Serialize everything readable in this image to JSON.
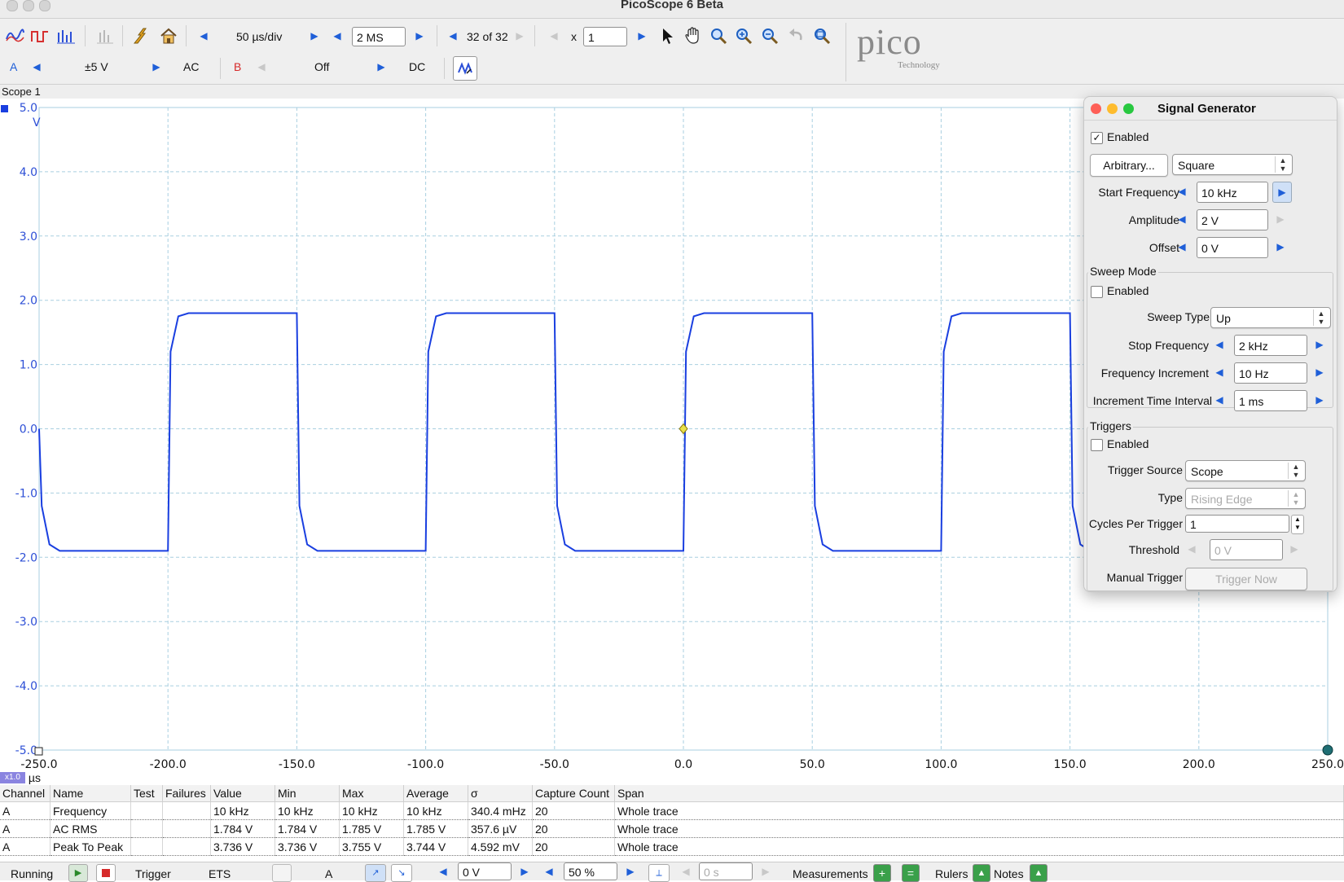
{
  "window": {
    "title": "PicoScope 6 Beta"
  },
  "toolbar": {
    "timebase": "50 µs/div",
    "samples": "2 MS",
    "capture": "32 of 32",
    "zoom_prefix": "x",
    "zoom_value": "1"
  },
  "channels": {
    "a": {
      "name": "A",
      "range": "±5 V",
      "coupling": "AC"
    },
    "b": {
      "name": "B",
      "range": "Off",
      "coupling": "DC"
    }
  },
  "logo": {
    "text": "pico",
    "sub": "Technology"
  },
  "scope": {
    "label": "Scope 1",
    "y_unit": "V",
    "x_unit": "µs",
    "x_scale_badge": "x1.0",
    "colors": {
      "trace": "#1a3fe0",
      "axis_text": "#2d4fd6",
      "grid": "#a9cfe0",
      "marker": "#e8e04a"
    }
  },
  "chart_data": {
    "type": "line",
    "x_range": [
      -250,
      250
    ],
    "y_range": [
      -5,
      5
    ],
    "x_ticks": [
      "-250.0",
      "-200.0",
      "-150.0",
      "-100.0",
      "-50.0",
      "0.0",
      "50.0",
      "100.0",
      "150.0",
      "200.0",
      "250.0"
    ],
    "y_ticks": [
      "5.0",
      "4.0",
      "3.0",
      "2.0",
      "1.0",
      "0.0",
      "-1.0",
      "-2.0",
      "-3.0",
      "-4.0",
      "-5.0"
    ],
    "grid": true,
    "series": [
      {
        "waveform": "square",
        "high": 1.8,
        "low": -1.9,
        "period_us": 100,
        "x": [
          -250,
          -249,
          -246,
          -242,
          -200,
          -199,
          -196,
          -192,
          -150,
          -149,
          -146,
          -142,
          -100,
          -99,
          -96,
          -92,
          -50,
          -49,
          -46,
          -42,
          0,
          1,
          4,
          8,
          50,
          51,
          54,
          58,
          100,
          101,
          104,
          108,
          150,
          151,
          154,
          158
        ],
        "y": [
          0,
          -1.2,
          -1.8,
          -1.9,
          -1.9,
          1.2,
          1.75,
          1.8,
          1.8,
          -1.2,
          -1.8,
          -1.9,
          -1.9,
          1.2,
          1.75,
          1.8,
          1.8,
          -1.2,
          -1.8,
          -1.9,
          -1.9,
          1.2,
          1.75,
          1.8,
          1.8,
          -1.2,
          -1.8,
          -1.9,
          -1.9,
          1.2,
          1.75,
          1.8,
          1.8,
          -1.2,
          -1.8,
          -1.9
        ]
      }
    ]
  },
  "signal_generator": {
    "title": "Signal Generator",
    "enabled_label": "Enabled",
    "enabled": true,
    "arbitrary_button": "Arbitrary...",
    "waveform": "Square",
    "start_frequency_label": "Start Frequency",
    "start_frequency": "10 kHz",
    "amplitude_label": "Amplitude",
    "amplitude": "2 V",
    "offset_label": "Offset",
    "offset": "0 V",
    "sweep": {
      "title": "Sweep Mode",
      "enabled_label": "Enabled",
      "sweep_type_label": "Sweep Type",
      "sweep_type": "Up",
      "stop_frequency_label": "Stop Frequency",
      "stop_frequency": "2 kHz",
      "frequency_increment_label": "Frequency Increment",
      "frequency_increment": "10 Hz",
      "increment_time_label": "Increment Time Interval",
      "increment_time": "1 ms"
    },
    "triggers": {
      "title": "Triggers",
      "enabled_label": "Enabled",
      "source_label": "Trigger Source",
      "source": "Scope",
      "type_label": "Type",
      "type": "Rising Edge",
      "cycles_label": "Cycles Per Trigger",
      "cycles": "1",
      "threshold_label": "Threshold",
      "threshold": "0 V",
      "manual_label": "Manual Trigger",
      "trigger_now": "Trigger Now"
    }
  },
  "measurements": {
    "headers": [
      "Channel",
      "Name",
      "Test",
      "Failures",
      "Value",
      "Min",
      "Max",
      "Average",
      "σ",
      "Capture Count",
      "Span"
    ],
    "rows": [
      [
        "A",
        "Frequency",
        "",
        "",
        "10 kHz",
        "10 kHz",
        "10 kHz",
        "10 kHz",
        "340.4 mHz",
        "20",
        "Whole trace"
      ],
      [
        "A",
        "AC RMS",
        "",
        "",
        "1.784 V",
        "1.784 V",
        "1.785 V",
        "1.785 V",
        "357.6 µV",
        "20",
        "Whole trace"
      ],
      [
        "A",
        "Peak To Peak",
        "",
        "",
        "3.736 V",
        "3.736 V",
        "3.755 V",
        "3.744 V",
        "4.592 mV",
        "20",
        "Whole trace"
      ]
    ]
  },
  "statusbar": {
    "running": "Running",
    "trigger": "Trigger",
    "ets": "ETS",
    "channel": "A",
    "threshold": "0 V",
    "pretrigger": "50 %",
    "delay": "0 s",
    "measurements": "Measurements",
    "rulers": "Rulers",
    "notes": "Notes"
  }
}
